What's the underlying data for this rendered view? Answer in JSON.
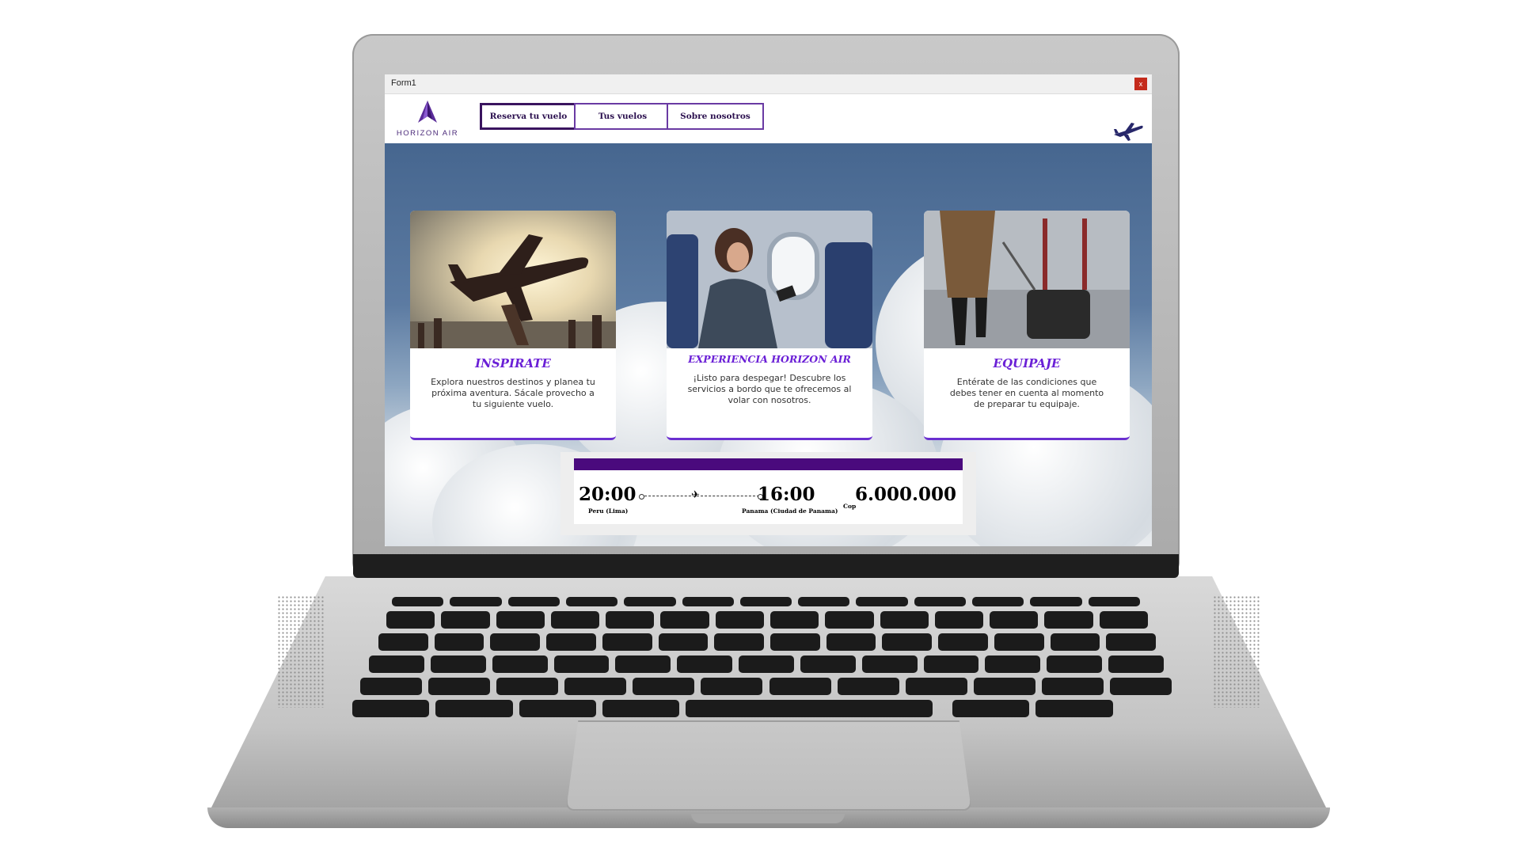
{
  "window": {
    "title": "Form1",
    "close_label": "x"
  },
  "brand": {
    "name": "HORIZON AIR"
  },
  "nav": {
    "items": [
      "Reserva tu vuelo",
      "Tus vuelos",
      "Sobre nosotros"
    ],
    "active_index": 0
  },
  "cards": [
    {
      "title": "INSPIRATE",
      "text": "Explora nuestros destinos y planea tu próxima aventura. Sácale provecho a tu siguiente vuelo."
    },
    {
      "title": "EXPERIENCIA HORIZON AIR",
      "text": "¡Listo para despegar! Descubre los servicios a bordo que te ofrecemos al volar con nosotros."
    },
    {
      "title": "EQUIPAJE",
      "text": "Entérate de las condiciones que debes tener en cuenta al momento de preparar tu equipaje."
    }
  ],
  "flight": {
    "depart_time": "20:00",
    "depart_place": "Peru (Lima)",
    "arrive_time": "16:00",
    "arrive_place": "Panama (Ciudad de Panama)",
    "currency": "Cop",
    "price": "6.000.000"
  },
  "colors": {
    "accent": "#6a1fd6",
    "ticket_bar": "#4a0a7d",
    "sky": "#45658f"
  }
}
